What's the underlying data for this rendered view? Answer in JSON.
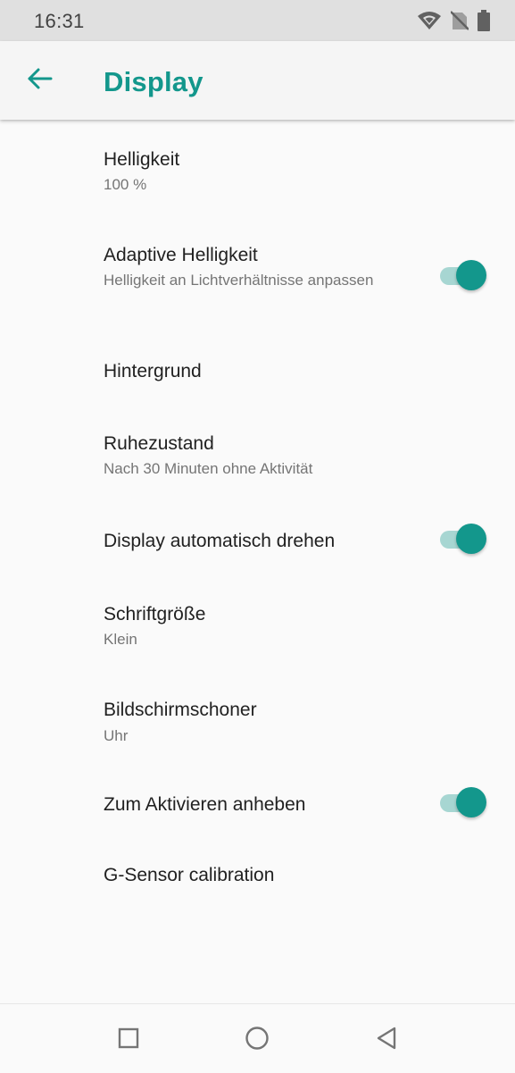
{
  "status_bar": {
    "time": "16:31",
    "icons": [
      "wifi-icon",
      "no-sim-icon",
      "battery-icon"
    ]
  },
  "app_bar": {
    "back_icon": "arrow-back-icon",
    "title": "Display"
  },
  "colors": {
    "accent": "#13978c",
    "toggle_track": "#a7d6d2",
    "title_text": "#212121",
    "summary_text": "#757575"
  },
  "settings": [
    {
      "title": "Helligkeit",
      "summary": "100 %"
    },
    {
      "title": "Adaptive Helligkeit",
      "summary": "Helligkeit an Lichtverhältnisse anpassen",
      "toggle": true
    },
    {
      "title": "Hintergrund"
    },
    {
      "title": "Ruhezustand",
      "summary": "Nach 30 Minuten ohne Aktivität"
    },
    {
      "title": "Display automatisch drehen",
      "toggle": true
    },
    {
      "title": "Schriftgröße",
      "summary": "Klein"
    },
    {
      "title": "Bildschirmschoner",
      "summary": "Uhr"
    },
    {
      "title": "Zum Aktivieren anheben",
      "toggle": true
    },
    {
      "title": "G-Sensor calibration"
    }
  ],
  "nav_bar": {
    "icons": [
      "recents-square-icon",
      "home-circle-icon",
      "back-triangle-icon"
    ]
  }
}
